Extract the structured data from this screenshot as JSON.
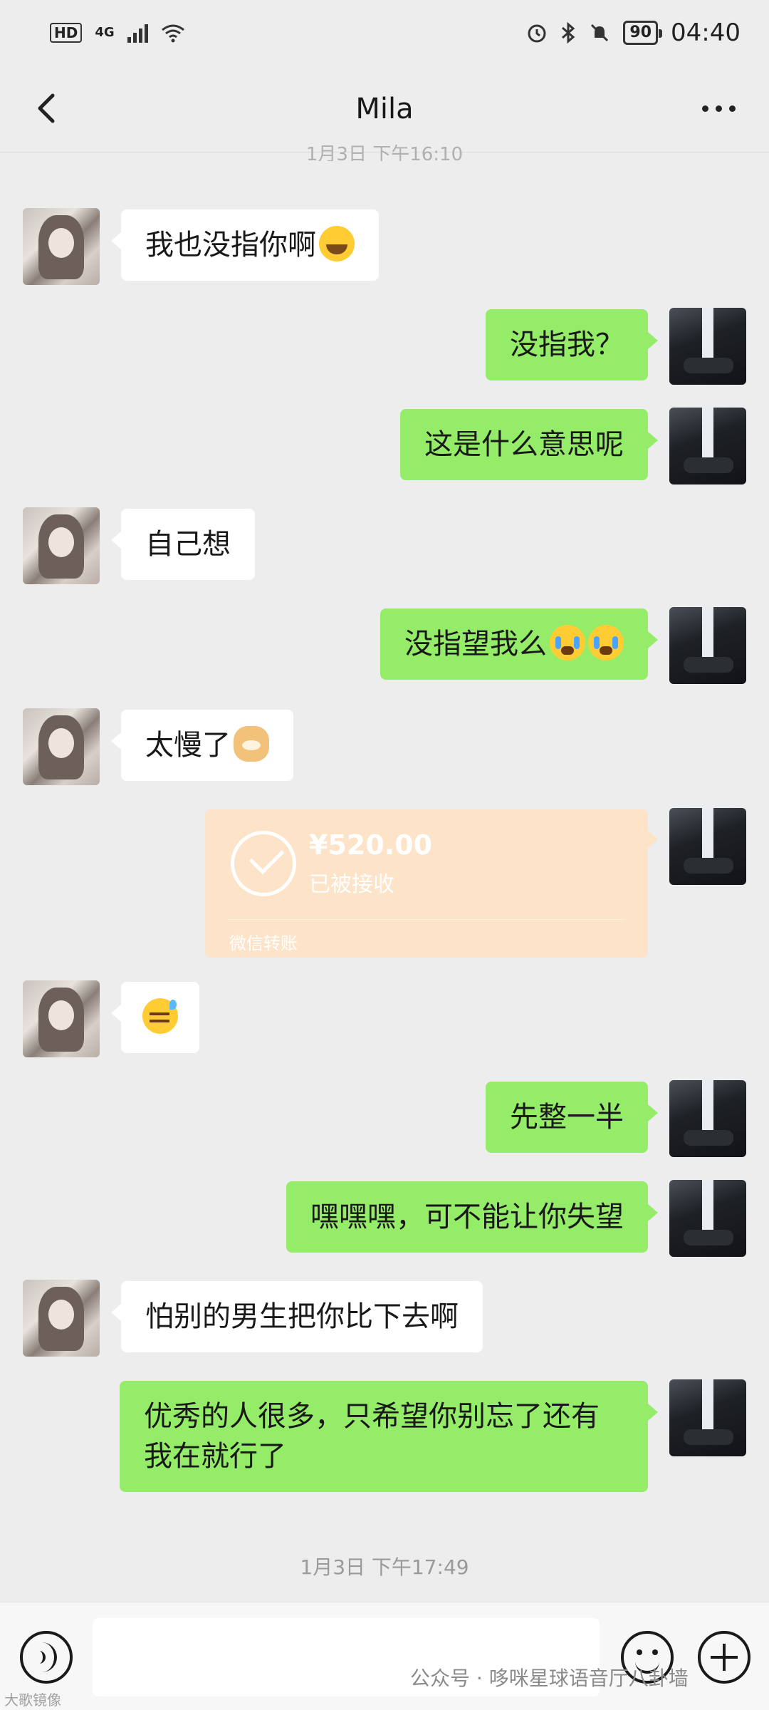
{
  "status_bar": {
    "hd": "HD",
    "network": "4G",
    "battery": "90",
    "time": "04:40",
    "icons": [
      "alarm-icon",
      "bluetooth-icon",
      "mute-icon",
      "wifi-icon",
      "signal-icon"
    ]
  },
  "header": {
    "title": "Mila",
    "back_icon": "chevron-left-icon",
    "more_icon": "more-icon"
  },
  "timestamp_top": "1月3日 下午16:10",
  "messages": [
    {
      "side": "her",
      "text": "我也没指你啊",
      "emoji": "rolling-laugh"
    },
    {
      "side": "me",
      "text": "没指我？"
    },
    {
      "side": "me",
      "text": "这是什么意思呢"
    },
    {
      "side": "her",
      "text": "自己想"
    },
    {
      "side": "me",
      "text": "没指望我么",
      "emoji": "crying-x2"
    },
    {
      "side": "her",
      "text": "太慢了",
      "emoji": "doge"
    },
    {
      "side": "me",
      "type": "transfer",
      "amount": "¥520.00",
      "status": "已被接收",
      "label": "微信转账"
    },
    {
      "side": "her",
      "emoji": "sweat"
    },
    {
      "side": "me",
      "text": "先整一半"
    },
    {
      "side": "me",
      "text": "嘿嘿嘿，可不能让你失望"
    },
    {
      "side": "her",
      "text": "怕别的男生把你比下去啊"
    },
    {
      "side": "me",
      "text": "优秀的人很多，只希望你别忘了还有我在就行了"
    }
  ],
  "timestamp_bottom": "1月3日 下午17:49",
  "input_bar": {
    "voice_icon": "voice-icon",
    "emoji_icon": "emoji-icon",
    "plus_icon": "plus-icon"
  },
  "watermark": "公众号 · 哆咪星球语音厅八卦墙",
  "watermark_small": "大歌镜像",
  "colors": {
    "bubble_me": "#95ec69",
    "bubble_her": "#ffffff",
    "background": "#ededed",
    "transfer": "#fde3c8"
  }
}
